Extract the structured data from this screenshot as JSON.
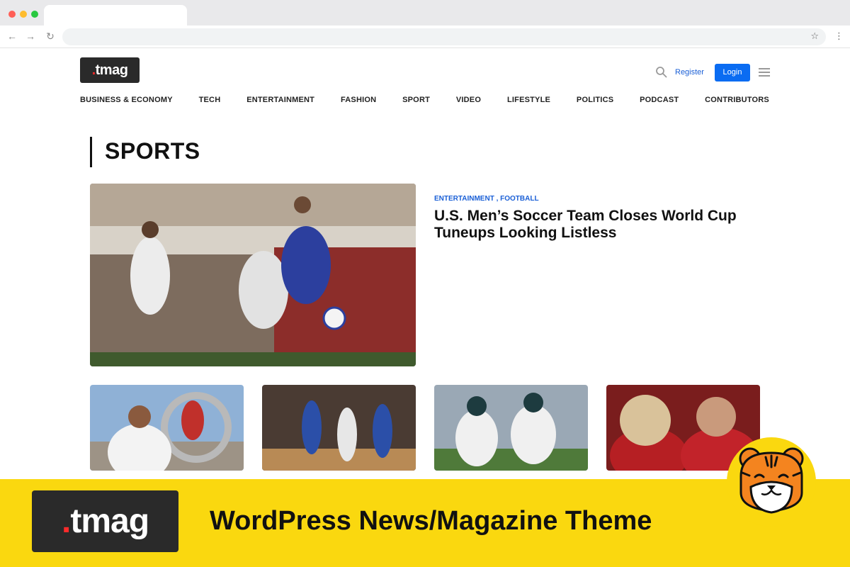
{
  "site": {
    "logo_prefix": ".",
    "logo_text": "tmag",
    "register_label": "Register",
    "login_label": "Login",
    "icons": [
      "search-icon",
      "hamburger-menu-icon"
    ]
  },
  "nav": {
    "items": [
      {
        "label": "BUSINESS & ECONOMY"
      },
      {
        "label": "TECH"
      },
      {
        "label": "ENTERTAINMENT"
      },
      {
        "label": "FASHION"
      },
      {
        "label": "SPORT"
      },
      {
        "label": "VIDEO"
      },
      {
        "label": "LIFESTYLE"
      },
      {
        "label": "POLITICS"
      },
      {
        "label": "PODCAST"
      },
      {
        "label": "CONTRIBUTORS"
      }
    ]
  },
  "section": {
    "title": "SPORTS"
  },
  "featured": {
    "meta": "ENTERTAINMENT , FOOTBALL",
    "title": "U.S. Men’s Soccer Team Closes World Cup Tuneups Looking Listless"
  },
  "banner": {
    "logo_prefix": ".",
    "logo_text": "tmag",
    "tagline": "WordPress News/Magazine Theme",
    "background_color": "#fad80f"
  },
  "colors": {
    "accent_blue": "#0a6cf2",
    "logo_dot_red": "#ff2b2b",
    "dark": "#2a2a2a"
  }
}
